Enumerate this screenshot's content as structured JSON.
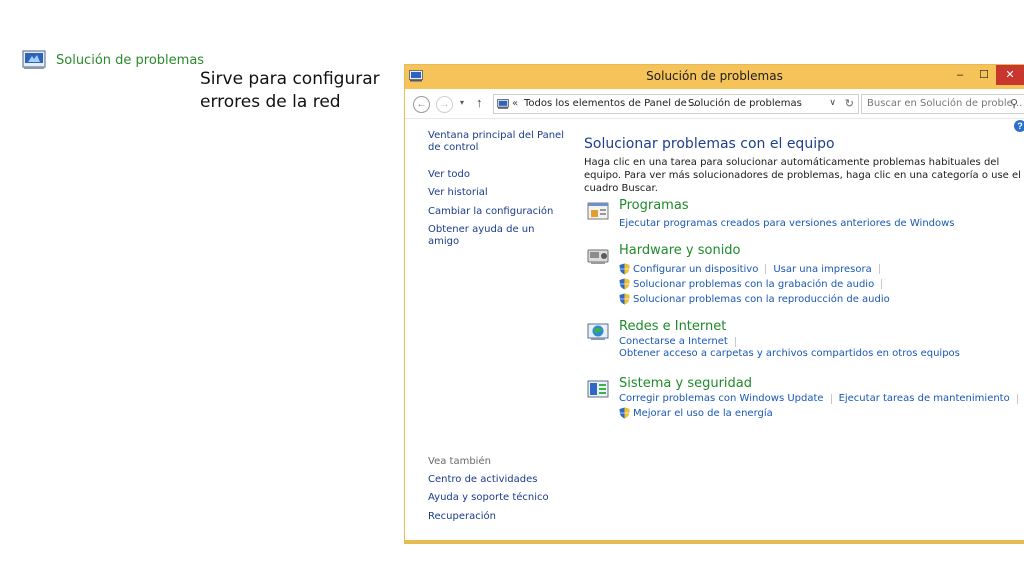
{
  "top_link": {
    "label": "Solución de problemas",
    "icon": "control-panel-icon"
  },
  "caption": {
    "line1": "Sirve para configurar",
    "line2": "errores de la red"
  },
  "window": {
    "title": "Solución de problemas",
    "controls": {
      "minimize": "–",
      "maximize": "☐",
      "close": "✕"
    },
    "colors": {
      "titlebar": "#f6c35a",
      "border": "#e6bb55",
      "close": "#c8372d"
    }
  },
  "address_bar": {
    "back": "←",
    "forward": "→",
    "recent": "▾",
    "up": "↑",
    "chevron_root": "«",
    "crumb1": "Todos los elementos de Panel de ...",
    "chevron_sep": "›",
    "crumb2": "Solución de problemas",
    "dropdown": "∨",
    "refresh": "↻",
    "search_placeholder": "Buscar en Solución de proble...",
    "search_icon": "⚲"
  },
  "sidebar": {
    "links": [
      {
        "label": "Ventana principal del Panel de control"
      },
      {
        "label": "Ver todo"
      },
      {
        "label": "Ver historial"
      },
      {
        "label": "Cambiar la configuración"
      },
      {
        "label": "Obtener ayuda de un amigo"
      }
    ],
    "see_also_heading": "Vea también",
    "see_also": [
      {
        "label": "Centro de actividades"
      },
      {
        "label": "Ayuda y soporte técnico"
      },
      {
        "label": "Recuperación"
      }
    ]
  },
  "main": {
    "heading": "Solucionar problemas con el equipo",
    "description": "Haga clic en una tarea para solucionar automáticamente problemas habituales del equipo. Para ver más solucionadores de problemas, haga clic en una categoría o use el cuadro Buscar.",
    "help": "?",
    "categories": [
      {
        "title": "Programas",
        "links": [
          "Ejecutar programas creados para versiones anteriores de Windows"
        ]
      },
      {
        "title": "Hardware y sonido",
        "links": [
          "Configurar un dispositivo",
          "Usar una impresora",
          "Solucionar problemas con la grabación de audio",
          "Solucionar problemas con la reproducción de audio"
        ]
      },
      {
        "title": "Redes e Internet",
        "links": [
          "Conectarse a Internet",
          "Obtener acceso a carpetas y archivos compartidos en otros equipos"
        ]
      },
      {
        "title": "Sistema y seguridad",
        "links": [
          "Corregir problemas con Windows Update",
          "Ejecutar tareas de mantenimiento",
          "Mejorar el uso de la energía"
        ]
      }
    ]
  }
}
